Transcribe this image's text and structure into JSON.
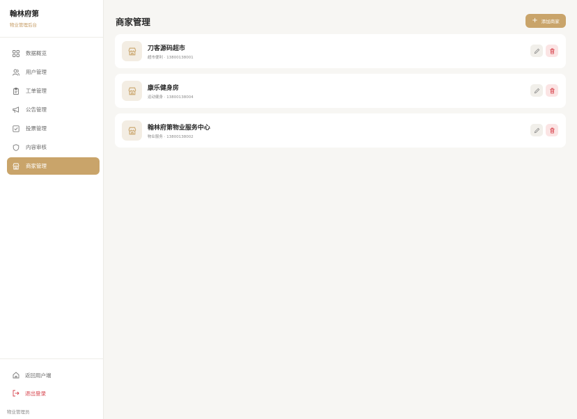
{
  "brand": {
    "title": "翰林府第",
    "subtitle": "物业管理后台"
  },
  "sidebar": {
    "items": [
      {
        "label": "数据概览",
        "icon": "grid-icon",
        "active": false
      },
      {
        "label": "用户管理",
        "icon": "users-icon",
        "active": false
      },
      {
        "label": "工单管理",
        "icon": "clipboard-icon",
        "active": false
      },
      {
        "label": "公告管理",
        "icon": "megaphone-icon",
        "active": false
      },
      {
        "label": "投票管理",
        "icon": "checkbox-icon",
        "active": false
      },
      {
        "label": "内容审核",
        "icon": "shield-icon",
        "active": false
      },
      {
        "label": "商家管理",
        "icon": "store-icon",
        "active": true
      }
    ],
    "footer": {
      "back_label": "返回用户端",
      "logout_label": "退出登录",
      "role": "物业管理员"
    }
  },
  "main": {
    "title": "商家管理",
    "add_button": "添加商家",
    "merchants": [
      {
        "name": "刀客源码超市",
        "meta": "超市便利 · 13800138001"
      },
      {
        "name": "康乐健身房",
        "meta": "运动健身 · 13800138004"
      },
      {
        "name": "翰林府第物业服务中心",
        "meta": "物业服务 · 13800138002"
      }
    ]
  },
  "colors": {
    "accent": "#c9a46a",
    "danger": "#d6404a",
    "background": "#f7f6f3"
  }
}
